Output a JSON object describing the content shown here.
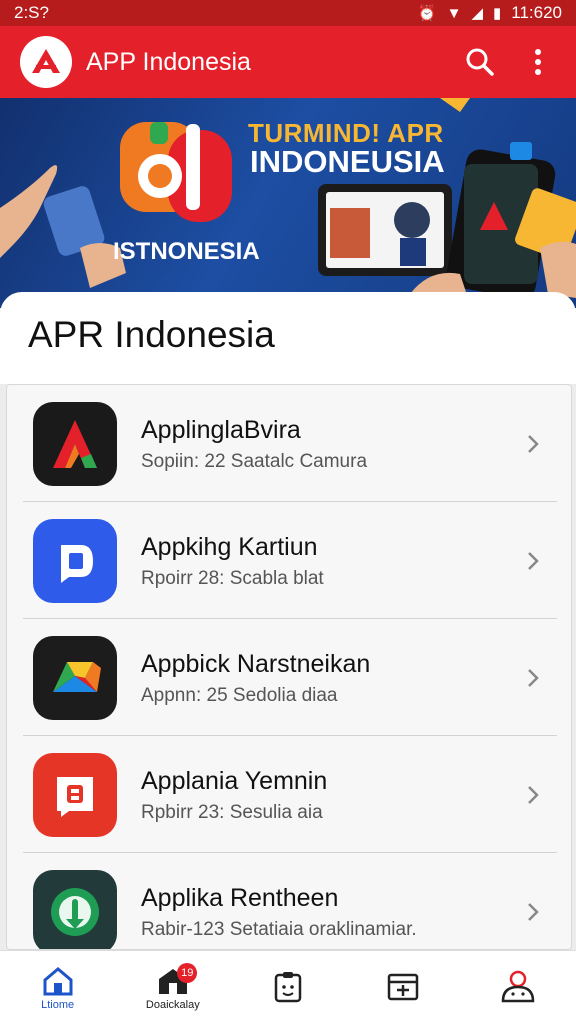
{
  "status_bar": {
    "time": "2:S?",
    "clock": "11:620"
  },
  "app_bar": {
    "title": "APP Indonesia"
  },
  "banner": {
    "headline": "TURMIND! APR",
    "subheadline": "INDONEUSIA",
    "caption": "ISTNONESIA"
  },
  "section": {
    "title": "APR Indonesia"
  },
  "apps": [
    {
      "title": "ApplinglaBvira",
      "subtitle": "Sopiin: 22 Saatalc Camura",
      "icon": "a-letter-app-icon",
      "icon_bg": "#1a1a1a"
    },
    {
      "title": "Appkihg Kartiun",
      "subtitle": "Rpoirr 28: Scabla blat",
      "icon": "d-letter-app-icon",
      "icon_bg": "#2f5bea"
    },
    {
      "title": "Appbick Narstneikan",
      "subtitle": "Appnn: 25 Sedolia diaa",
      "icon": "prism-app-icon",
      "icon_bg": "#1c1c1c"
    },
    {
      "title": "Applania Yemnin",
      "subtitle": "Rpbirr 23: Sesulia aia",
      "icon": "b-letter-app-icon",
      "icon_bg": "#e53527"
    },
    {
      "title": "Applika Rentheen",
      "subtitle": "Rabir-123 Setatiaia oraklinamiar.",
      "icon": "green-shield-app-icon",
      "icon_bg": "#223a3a"
    }
  ],
  "bottom_nav": [
    {
      "label": "Ltiome",
      "icon": "home-icon",
      "active": true
    },
    {
      "label": "Doaickalay",
      "icon": "store-icon",
      "active": false,
      "badge": "19"
    },
    {
      "label": "",
      "icon": "clipboard-face-icon",
      "active": false
    },
    {
      "label": "",
      "icon": "calendar-plus-icon",
      "active": false
    },
    {
      "label": "",
      "icon": "profile-icon",
      "active": false
    }
  ],
  "colors": {
    "primary": "#e4202a",
    "status_bar": "#b71c1c",
    "active_nav": "#1e54c9",
    "banner_headline": "#f7b733"
  }
}
